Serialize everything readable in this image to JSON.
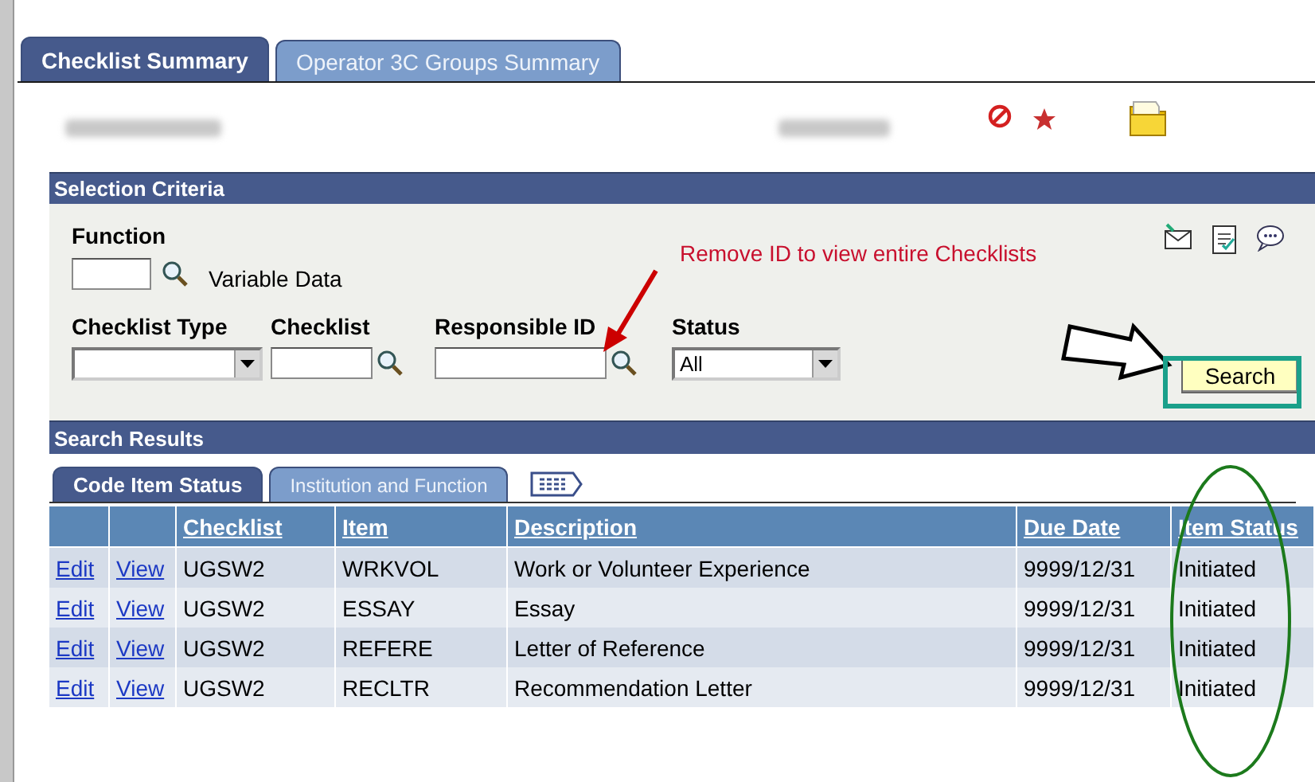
{
  "tabs": [
    {
      "label": "Checklist Summary",
      "selected": true
    },
    {
      "label": "Operator 3C Groups Summary",
      "selected": false
    }
  ],
  "selection_criteria": {
    "title": "Selection Criteria",
    "function": {
      "label": "Function",
      "note": "Variable Data"
    },
    "fields": [
      {
        "label": "Checklist Type",
        "kind": "dropdown"
      },
      {
        "label": "Checklist",
        "kind": "lookup"
      },
      {
        "label": "Responsible ID",
        "kind": "lookup"
      },
      {
        "label": "Status",
        "kind": "dropdown",
        "value": "All"
      }
    ],
    "search_button": "Search"
  },
  "annotation": {
    "text": "Remove ID to view entire Checklists"
  },
  "search_results": {
    "title": "Search Results",
    "tabs": [
      {
        "label": "Code Item Status",
        "selected": true
      },
      {
        "label": "Institution and Function",
        "selected": false
      }
    ],
    "columns": [
      "",
      "",
      "Checklist",
      "Item",
      "Description",
      "Due Date",
      "Item Status"
    ],
    "rows": [
      {
        "edit": "Edit",
        "view": "View",
        "checklist": "UGSW2",
        "item": "WRKVOL",
        "description": "Work or Volunteer Experience",
        "due_date": "9999/12/31",
        "item_status": "Initiated"
      },
      {
        "edit": "Edit",
        "view": "View",
        "checklist": "UGSW2",
        "item": "ESSAY",
        "description": "Essay",
        "due_date": "9999/12/31",
        "item_status": "Initiated"
      },
      {
        "edit": "Edit",
        "view": "View",
        "checklist": "UGSW2",
        "item": "REFERE",
        "description": "Letter of Reference",
        "due_date": "9999/12/31",
        "item_status": "Initiated"
      },
      {
        "edit": "Edit",
        "view": "View",
        "checklist": "UGSW2",
        "item": "RECLTR",
        "description": "Recommendation Letter",
        "due_date": "9999/12/31",
        "item_status": "Initiated"
      }
    ]
  }
}
